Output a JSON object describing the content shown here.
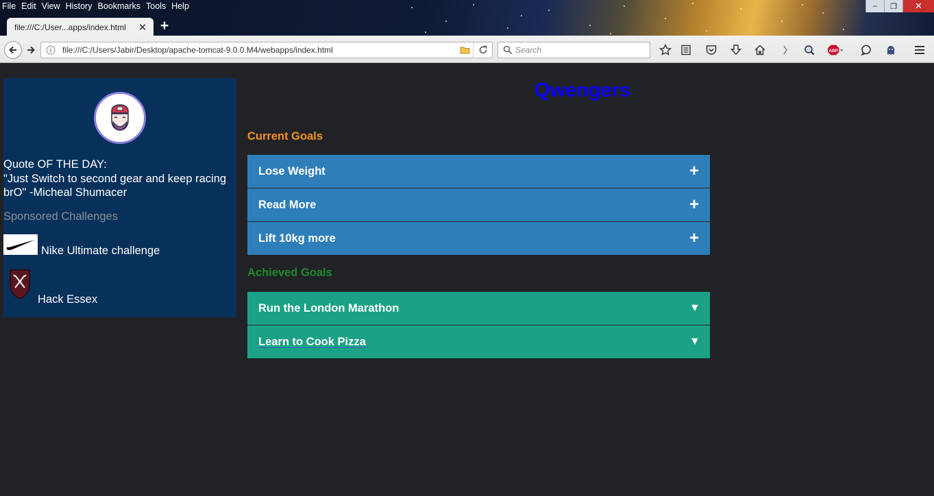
{
  "browser": {
    "menu": [
      "File",
      "Edit",
      "View",
      "History",
      "Bookmarks",
      "Tools",
      "Help"
    ],
    "tab_title": "file:///C:/User...apps/index.html",
    "url": "file:///C:/Users/Jabir/Desktop/apache-tomcat-9.0.0.M4/webapps/index.html",
    "search_placeholder": "Search",
    "window_controls": [
      "minimize-icon",
      "maximize-icon",
      "close-icon"
    ],
    "toolbar_icons": [
      "star-icon",
      "reading-list-icon",
      "pocket-icon",
      "download-icon",
      "home-icon",
      "extension-icon",
      "adblock-icon",
      "chat-icon",
      "ghost-icon",
      "menu-icon"
    ]
  },
  "sidebar": {
    "quote_heading": "Quote OF THE DAY:",
    "quote_text": "\"Just Switch to second gear and keep racing brO\" -Micheal Shumacer",
    "sponsored_heading": "Sponsored Challenges",
    "challenges": [
      {
        "label": "Nike Ultimate challenge",
        "icon": "nike-logo"
      },
      {
        "label": "Hack Essex",
        "icon": "hack-essex-logo"
      }
    ]
  },
  "main": {
    "title": "Qwengers",
    "current_heading": "Current Goals",
    "achieved_heading": "Achieved Goals",
    "current_goals": [
      {
        "label": "Lose Weight",
        "toggle": "+"
      },
      {
        "label": "Read More",
        "toggle": "+"
      },
      {
        "label": "Lift 10kg more",
        "toggle": "+"
      }
    ],
    "achieved_goals": [
      {
        "label": "Run the London Marathon",
        "toggle": "▼"
      },
      {
        "label": "Learn to Cook Pizza",
        "toggle": "▼"
      }
    ]
  },
  "colors": {
    "page_bg": "#212226",
    "sidebar_bg": "#07305a",
    "title": "#0a00ff",
    "current_heading": "#f3921d",
    "achieved_heading": "#1c8a2a",
    "current_goal_bg": "#2e7fb9",
    "achieved_goal_bg": "#1ba286"
  }
}
